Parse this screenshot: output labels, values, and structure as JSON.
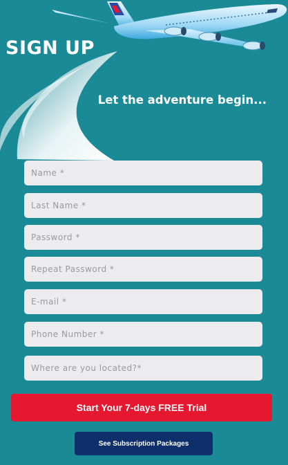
{
  "header": {
    "title": "SIGN UP",
    "tagline": "Let the adventure begin..."
  },
  "form": {
    "fields": [
      {
        "placeholder": "Name *"
      },
      {
        "placeholder": "Last Name *"
      },
      {
        "placeholder": "Password *"
      },
      {
        "placeholder": "Repeat Password *"
      },
      {
        "placeholder": "E-mail *"
      },
      {
        "placeholder": "Phone Number *"
      },
      {
        "placeholder": "Where are you located?*"
      }
    ],
    "primary_button": "Start Your 7-days FREE Trial",
    "secondary_button": "See Subscription Packages"
  },
  "colors": {
    "background": "#1a8a96",
    "field": "#ececee",
    "primary": "#e5182f",
    "secondary": "#0f2f6b"
  },
  "icons": [
    "airplane-illustration",
    "swoosh-trail"
  ]
}
